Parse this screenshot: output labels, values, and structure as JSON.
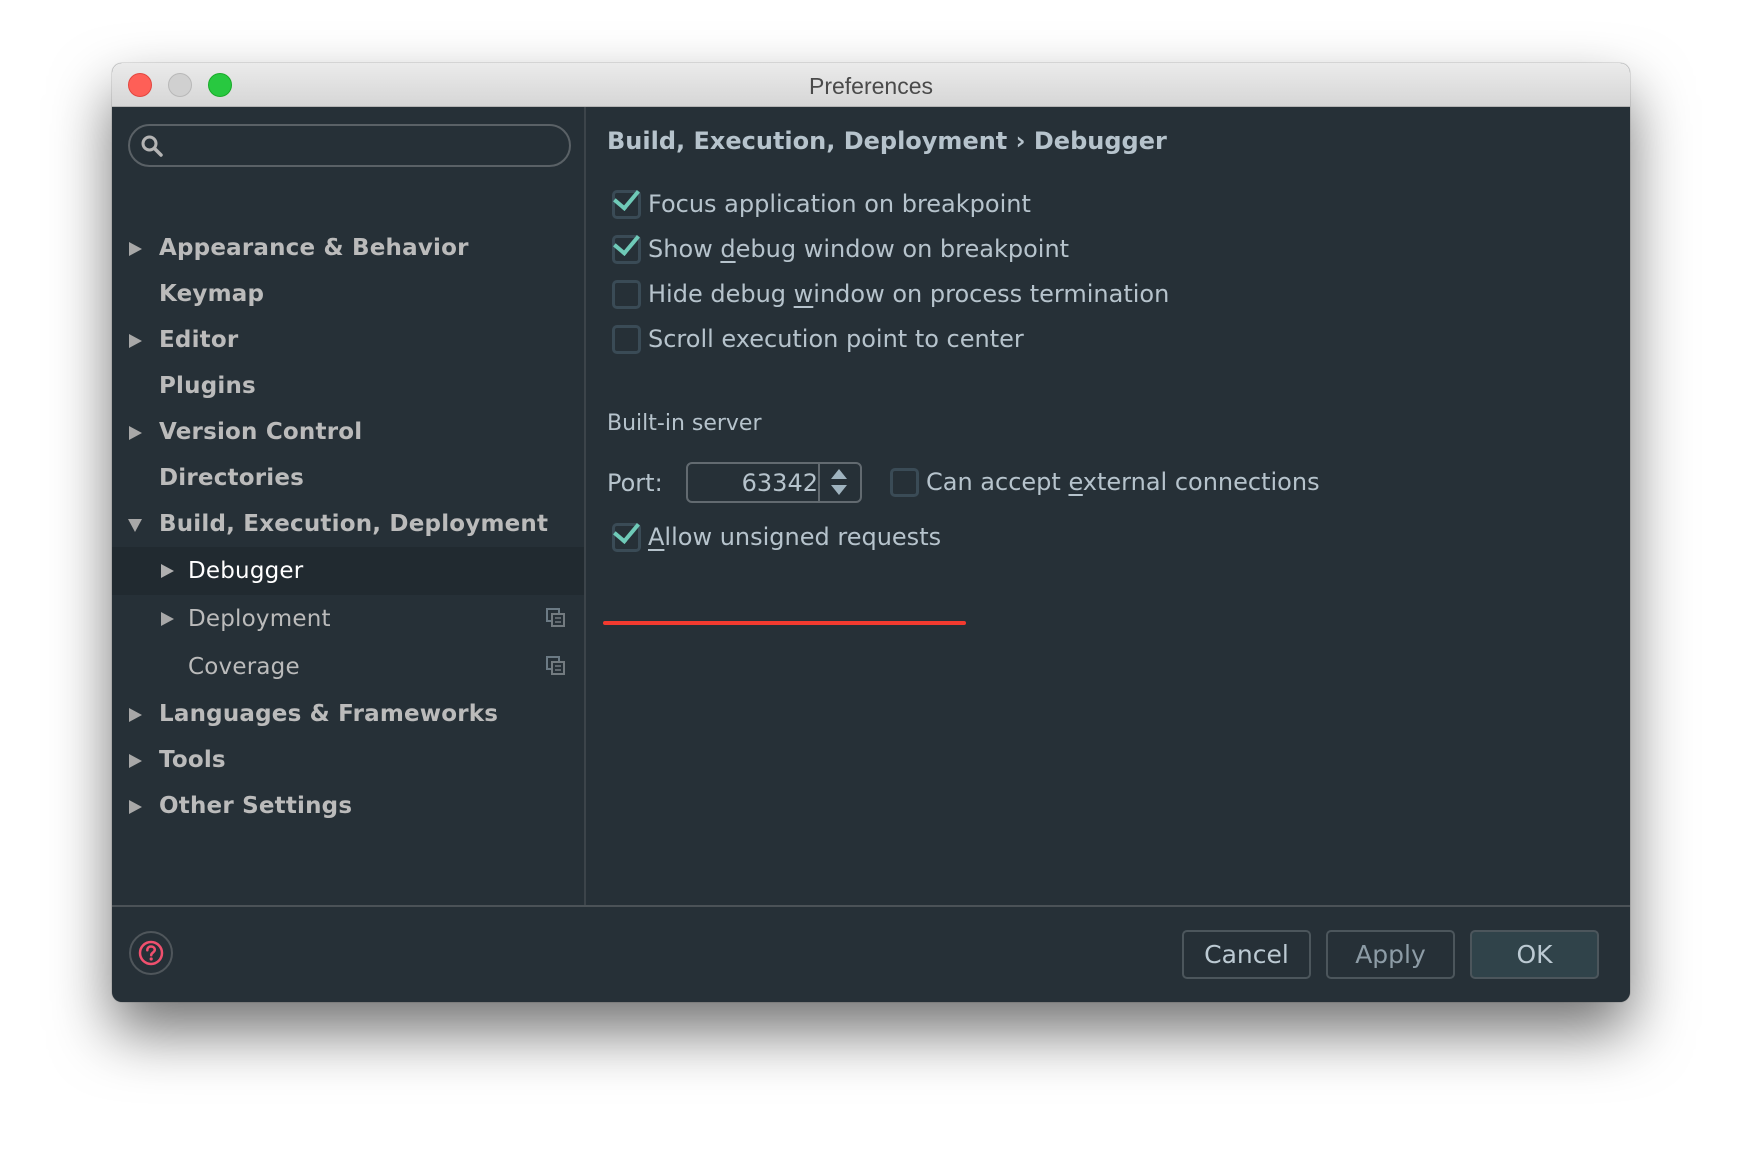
{
  "window": {
    "title": "Preferences",
    "traffic_lights": [
      "close",
      "minimize",
      "maximize"
    ]
  },
  "sidebar": {
    "search": {
      "placeholder": "",
      "value": "",
      "icon": "search-icon"
    },
    "items": [
      {
        "label": "Appearance & Behavior",
        "expandable": true,
        "expanded": false,
        "level": 0
      },
      {
        "label": "Keymap",
        "expandable": false,
        "level": 0
      },
      {
        "label": "Editor",
        "expandable": true,
        "expanded": false,
        "level": 0
      },
      {
        "label": "Plugins",
        "expandable": false,
        "level": 0
      },
      {
        "label": "Version Control",
        "expandable": true,
        "expanded": false,
        "level": 0
      },
      {
        "label": "Directories",
        "expandable": false,
        "level": 0
      },
      {
        "label": "Build, Execution, Deployment",
        "expandable": true,
        "expanded": true,
        "level": 0
      },
      {
        "label": "Debugger",
        "expandable": true,
        "expanded": false,
        "level": 1,
        "selected": true
      },
      {
        "label": "Deployment",
        "expandable": true,
        "expanded": false,
        "level": 1,
        "project_icon": "project-settings-icon"
      },
      {
        "label": "Coverage",
        "expandable": false,
        "level": 1,
        "project_icon": "project-settings-icon"
      },
      {
        "label": "Languages & Frameworks",
        "expandable": true,
        "expanded": false,
        "level": 0
      },
      {
        "label": "Tools",
        "expandable": true,
        "expanded": false,
        "level": 0
      },
      {
        "label": "Other Settings",
        "expandable": true,
        "expanded": false,
        "level": 0
      }
    ]
  },
  "content": {
    "breadcrumb": "Build, Execution, Deployment › Debugger",
    "options": [
      {
        "label_pre": "Focus application on breakpoint",
        "mnemonic": "",
        "label_post": "",
        "checked": true
      },
      {
        "label_pre": "Show ",
        "mnemonic": "d",
        "label_post": "ebug window on breakpoint",
        "checked": true
      },
      {
        "label_pre": "Hide debug ",
        "mnemonic": "w",
        "label_post": "indow on process termination",
        "checked": false
      },
      {
        "label_pre": "Scroll execution point to center",
        "mnemonic": "",
        "label_post": "",
        "checked": false
      }
    ],
    "builtin_server": {
      "section_label": "Built-in server",
      "port_label": "Port:",
      "port_value": "63342",
      "external": {
        "label_pre": "Can accept ",
        "mnemonic": "e",
        "label_post": "xternal connections",
        "checked": false
      },
      "unsigned": {
        "label_pre": "",
        "mnemonic": "A",
        "label_post": "llow unsigned requests",
        "checked": true,
        "highlighted": true
      }
    }
  },
  "footer": {
    "help_icon": "help-icon",
    "cancel_label": "Cancel",
    "apply_label": "Apply",
    "ok_label": "OK"
  },
  "colors": {
    "accent_check": "#6fcab8",
    "highlight_underline": "#f23a2f",
    "help_icon": "#f0506e",
    "background": "#263037"
  }
}
